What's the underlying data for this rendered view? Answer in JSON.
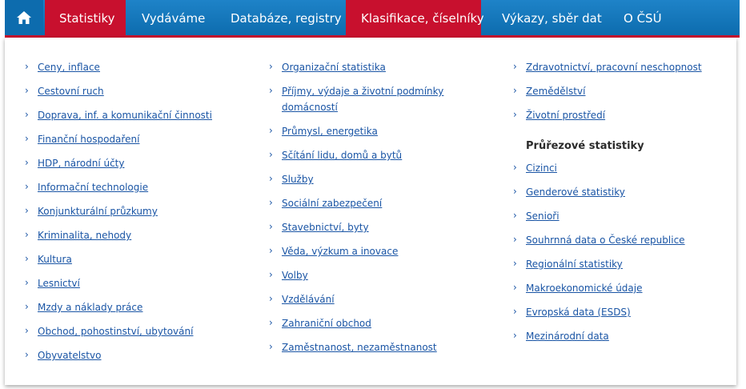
{
  "nav": {
    "home_icon": "home-icon",
    "tabs": [
      {
        "label": "Statistiky"
      },
      {
        "label": "Vydáváme"
      },
      {
        "label": "Databáze, registry"
      },
      {
        "label": "Klasifikace, číselníky"
      },
      {
        "label": "Výkazy, sběr dat"
      },
      {
        "label": "O ČSÚ"
      }
    ],
    "accent_color": "#c8102e",
    "bar_color": "#1276bc"
  },
  "menu": {
    "link_color": "#1a55a5",
    "col1": [
      {
        "label": "Ceny, inflace"
      },
      {
        "label": "Cestovní ruch"
      },
      {
        "label": "Doprava, inf. a komunikační činnosti"
      },
      {
        "label": "Finanční hospodaření"
      },
      {
        "label": "HDP, národní účty"
      },
      {
        "label": "Informační technologie"
      },
      {
        "label": "Konjunkturální průzkumy"
      },
      {
        "label": "Kriminalita, nehody"
      },
      {
        "label": "Kultura"
      },
      {
        "label": "Lesnictví"
      },
      {
        "label": "Mzdy a náklady práce"
      },
      {
        "label": "Obchod, pohostinství, ubytování"
      },
      {
        "label": "Obyvatelstvo"
      }
    ],
    "col2": [
      {
        "label": "Organizační statistika"
      },
      {
        "line1": "Příjmy, výdaje a životní podmínky",
        "line2": "domácností"
      },
      {
        "label": "Průmysl, energetika"
      },
      {
        "label": "Sčítání lidu, domů a bytů"
      },
      {
        "label": "Služby"
      },
      {
        "label": "Sociální zabezpečení"
      },
      {
        "label": "Stavebnictví, byty"
      },
      {
        "label": "Věda, výzkum a inovace"
      },
      {
        "label": "Volby"
      },
      {
        "label": "Vzdělávání"
      },
      {
        "label": "Zahraniční obchod"
      },
      {
        "label": "Zaměstnanost, nezaměstnanost"
      }
    ],
    "col3_top": [
      {
        "label": "Zdravotnictví, pracovní neschopnost"
      },
      {
        "label": "Zemědělství"
      },
      {
        "label": "Životní prostředí"
      }
    ],
    "cross_section": {
      "heading": "Průřezové statistiky",
      "items": [
        {
          "label": "Cizinci"
        },
        {
          "label": "Genderové statistiky"
        },
        {
          "label": "Senioři"
        },
        {
          "label": "Souhrnná data o České republice"
        },
        {
          "label": "Regionální statistiky"
        },
        {
          "label": "Makroekonomické údaje"
        },
        {
          "label": "Evropská data (ESDS)"
        },
        {
          "label": "Mezinárodní data"
        }
      ]
    },
    "bullet_glyph": "›"
  }
}
